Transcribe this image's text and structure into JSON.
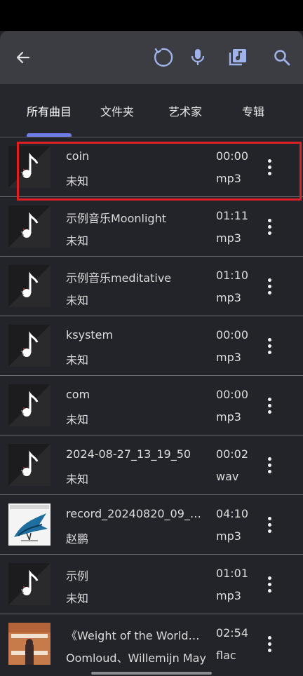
{
  "toolbar": {
    "back_icon": "arrow-back-icon",
    "refresh_icon": "refresh-icon",
    "mic_icon": "microphone-icon",
    "library_icon": "music-library-icon",
    "search_icon": "search-icon"
  },
  "tabs": [
    {
      "label": "所有曲目",
      "active": true
    },
    {
      "label": "文件夹",
      "active": false
    },
    {
      "label": "艺术家",
      "active": false
    },
    {
      "label": "专辑",
      "active": false
    }
  ],
  "accent_color": "#6f7de8",
  "highlight_color": "#e01f25",
  "songs": [
    {
      "title": "coin",
      "artist": "未知",
      "duration": "00:00",
      "format": "mp3",
      "art": "note-icon"
    },
    {
      "title": "示例音乐Moonlight",
      "artist": "未知",
      "duration": "01:11",
      "format": "mp3",
      "art": "note-icon"
    },
    {
      "title": "示例音乐meditative",
      "artist": "未知",
      "duration": "01:10",
      "format": "mp3",
      "art": "note-icon"
    },
    {
      "title": "ksystem",
      "artist": "未知",
      "duration": "00:00",
      "format": "mp3",
      "art": "note-icon"
    },
    {
      "title": "com",
      "artist": "未知",
      "duration": "00:00",
      "format": "mp3",
      "art": "note-icon"
    },
    {
      "title": "2024-08-27_13_19_50",
      "artist": "未知",
      "duration": "00:02",
      "format": "wav",
      "art": "note-icon"
    },
    {
      "title": "record_20240820_09_38…",
      "artist": "赵鹏",
      "duration": "04:10",
      "format": "mp3",
      "art": "album-art-bird"
    },
    {
      "title": "示例",
      "artist": "未知",
      "duration": "01:01",
      "format": "mp3",
      "art": "note-icon"
    },
    {
      "title": "《Weight of the World》…",
      "artist": "Oomloud、Willemijn May",
      "duration": "02:54",
      "format": "flac",
      "art": "album-art-weight"
    }
  ]
}
